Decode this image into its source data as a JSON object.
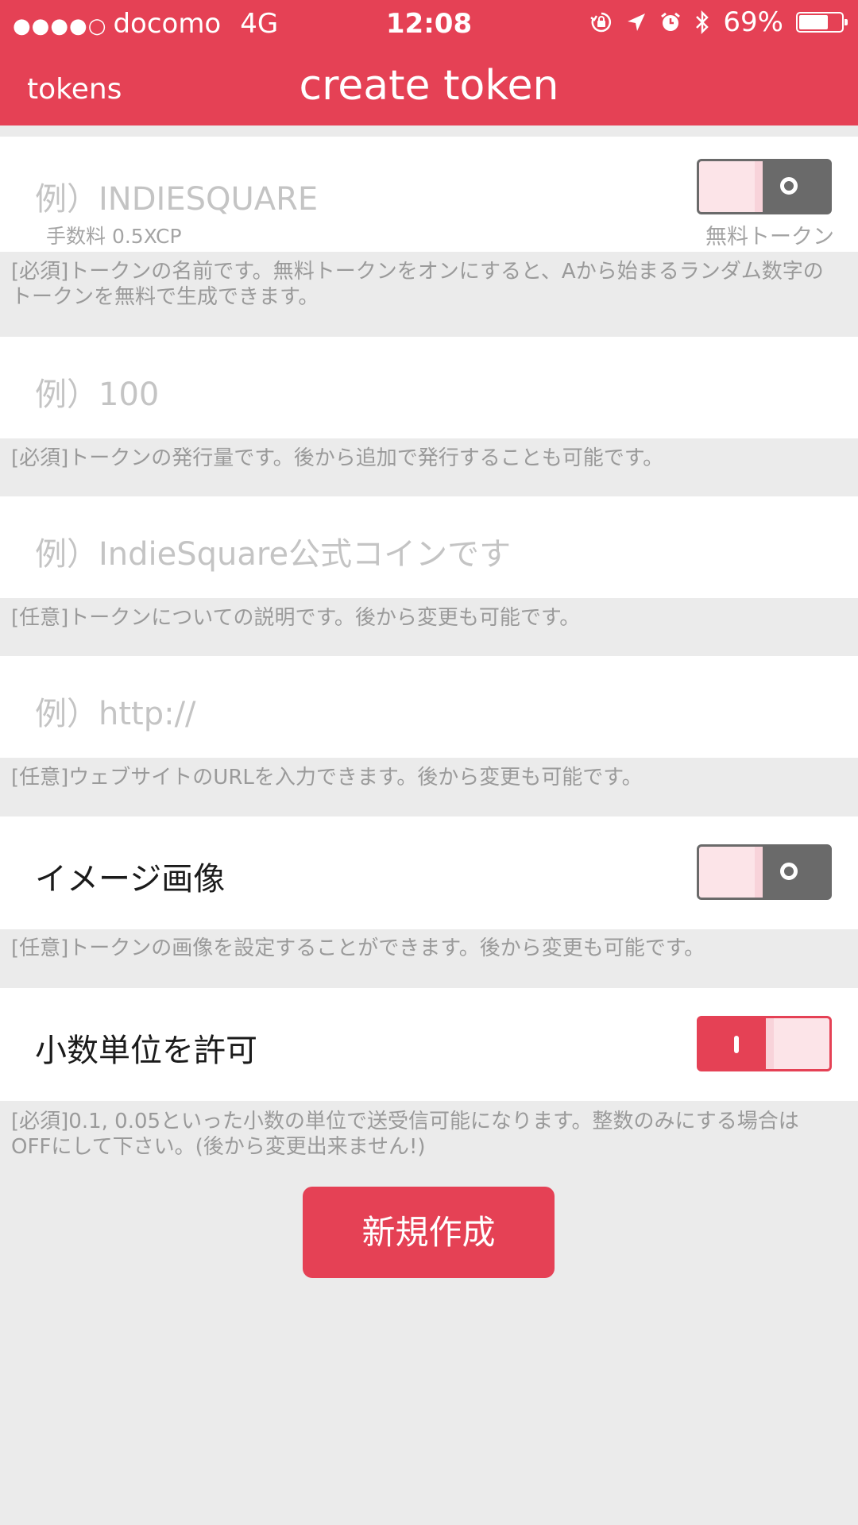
{
  "status_bar": {
    "signal_dots": "●●●●○",
    "carrier": "docomo",
    "network": "4G",
    "time": "12:08",
    "battery_percent": "69%",
    "battery_level": 0.69,
    "icons": [
      "orientation-lock-icon",
      "location-arrow-icon",
      "alarm-icon",
      "bluetooth-icon",
      "battery-icon"
    ]
  },
  "nav": {
    "back_label": "tokens",
    "title": "create token"
  },
  "form": {
    "name": {
      "placeholder": "例）INDIESQUARE",
      "fee": "手数料 0.5XCP",
      "free_token_label": "無料トークン",
      "free_token_on": false,
      "hint": "[必須]トークンの名前です。無料トークンをオンにすると、Aから始まるランダム数字のトークンを無料で生成できます。"
    },
    "amount": {
      "placeholder": "例）100",
      "hint": "[必須]トークンの発行量です。後から追加で発行することも可能です。"
    },
    "description": {
      "placeholder": "例）IndieSquare公式コインです",
      "hint": "[任意]トークンについての説明です。後から変更も可能です。"
    },
    "website": {
      "placeholder": "例）http://",
      "hint": "[任意]ウェブサイトのURLを入力できます。後から変更も可能です。"
    },
    "image": {
      "label": "イメージ画像",
      "on": false,
      "hint": "[任意]トークンの画像を設定することができます。後から変更も可能です。"
    },
    "decimal": {
      "label": "小数単位を許可",
      "on": true,
      "hint": "[必須]0.1, 0.05といった小数の単位で送受信可能になります。整数のみにする場合はOFFにして下さい。(後から変更出来ません!)"
    }
  },
  "create_button": "新規作成",
  "colors": {
    "accent": "#e54155",
    "background": "#ebebeb",
    "toggle_off": "#6a6a6a",
    "toggle_knob": "#fce4e8"
  }
}
